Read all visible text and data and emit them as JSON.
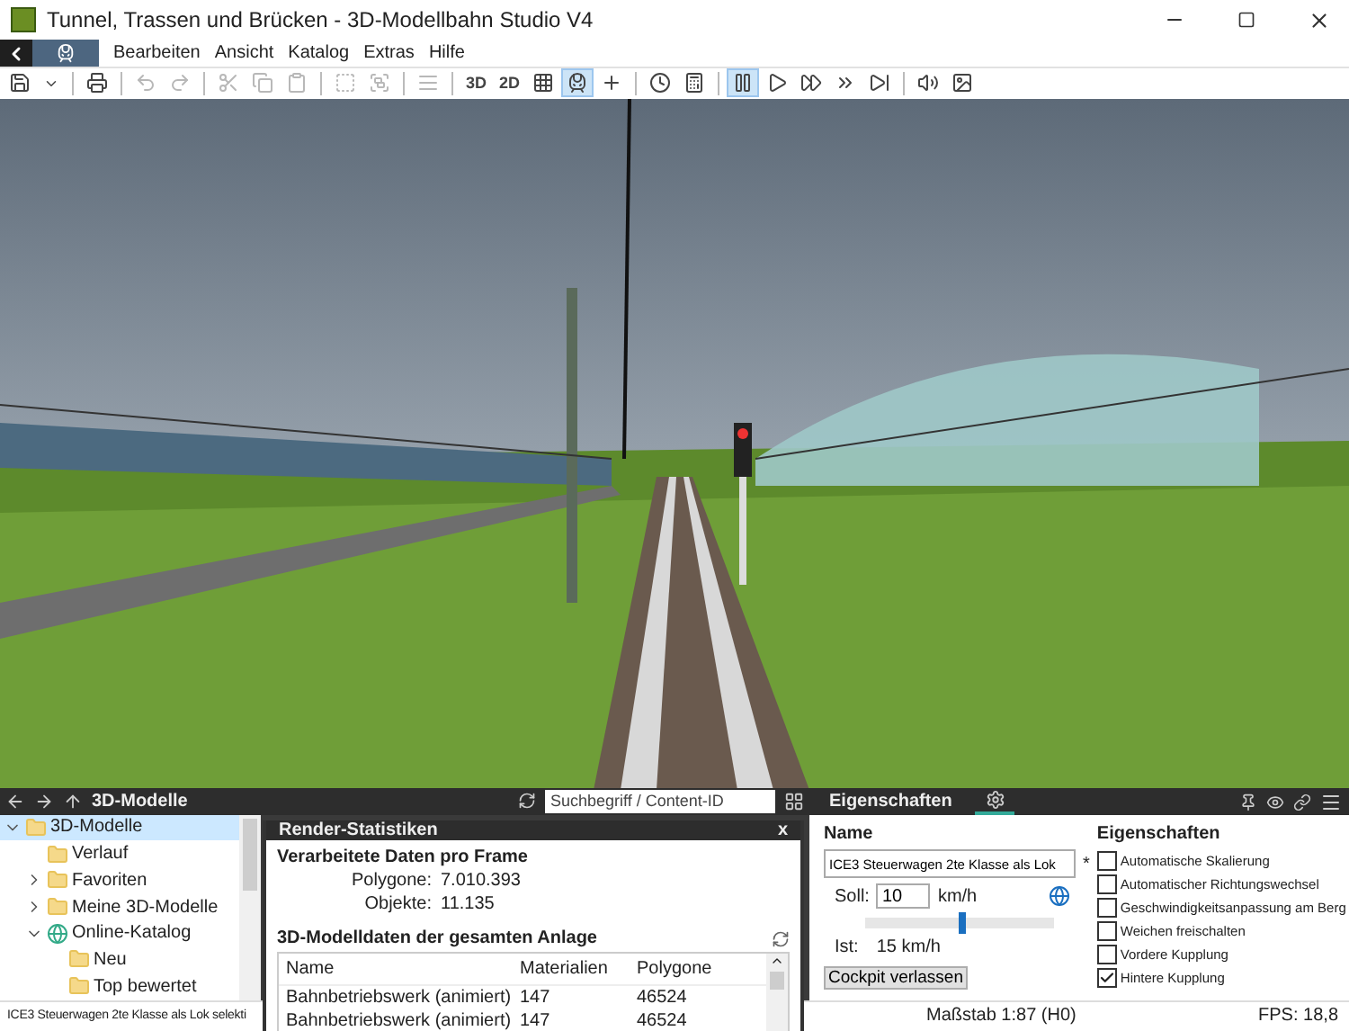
{
  "window": {
    "title": "Tunnel, Trassen und Brücken - 3D-Modellbahn Studio V4"
  },
  "menu": {
    "mode_tab_selected": true,
    "items": [
      "Bearbeiten",
      "Ansicht",
      "Katalog",
      "Extras",
      "Hilfe"
    ]
  },
  "toolbar": [
    {
      "kind": "icon",
      "selected": false,
      "disabled": false
    },
    {
      "kind": "caret",
      "selected": false,
      "disabled": false
    },
    {
      "kind": "separator"
    },
    {
      "kind": "icon",
      "selected": false,
      "disabled": false
    },
    {
      "kind": "separator"
    },
    {
      "kind": "icon",
      "selected": false,
      "disabled": true
    },
    {
      "kind": "icon",
      "selected": false,
      "disabled": true
    },
    {
      "kind": "separator"
    },
    {
      "kind": "icon",
      "selected": false,
      "disabled": true
    },
    {
      "kind": "icon",
      "selected": false,
      "disabled": true
    },
    {
      "kind": "icon",
      "selected": false,
      "disabled": true
    },
    {
      "kind": "separator"
    },
    {
      "kind": "icon",
      "selected": false,
      "disabled": true
    },
    {
      "kind": "icon",
      "selected": false,
      "disabled": true
    },
    {
      "kind": "separator"
    },
    {
      "kind": "icon",
      "selected": false,
      "disabled": true
    },
    {
      "kind": "separator"
    },
    {
      "kind": "text",
      "label": "3D",
      "selected": false,
      "disabled": false
    },
    {
      "kind": "text",
      "label": "2D",
      "selected": false,
      "disabled": false
    },
    {
      "kind": "icon",
      "selected": false,
      "disabled": false
    },
    {
      "kind": "icon",
      "selected": true,
      "disabled": false
    },
    {
      "kind": "icon",
      "selected": false,
      "disabled": false
    },
    {
      "kind": "separator"
    },
    {
      "kind": "icon",
      "selected": false,
      "disabled": false
    },
    {
      "kind": "icon",
      "selected": false,
      "disabled": false
    },
    {
      "kind": "separator"
    },
    {
      "kind": "icon",
      "selected": true,
      "disabled": false
    },
    {
      "kind": "icon",
      "selected": false,
      "disabled": false
    },
    {
      "kind": "icon",
      "selected": false,
      "disabled": false
    },
    {
      "kind": "icon",
      "selected": false,
      "disabled": false
    },
    {
      "kind": "icon",
      "selected": false,
      "disabled": false
    },
    {
      "kind": "separator"
    },
    {
      "kind": "icon",
      "selected": false,
      "disabled": false
    },
    {
      "kind": "icon",
      "selected": false,
      "disabled": false
    }
  ],
  "catalog": {
    "title": "3D-Modelle",
    "search": {
      "placeholder": "Suchbegriff / Content-ID"
    },
    "tree": [
      {
        "label": "3D-Modelle",
        "selected": true,
        "expanded": true,
        "children": [
          {
            "label": "Verlauf",
            "selected": false
          },
          {
            "label": "Favoriten",
            "selected": false,
            "expanded": false
          },
          {
            "label": "Meine 3D-Modelle",
            "selected": false,
            "expanded": false
          },
          {
            "label": "Online-Katalog",
            "selected": false,
            "expanded": true,
            "children": [
              {
                "label": "Neu",
                "selected": false
              },
              {
                "label": "Top bewertet",
                "selected": false
              }
            ]
          }
        ]
      }
    ],
    "status": "ICE3 Steuerwagen 2te Klasse als Lok selekti"
  },
  "render_stats": {
    "title": "Render-Statistiken",
    "close": "x",
    "section_1": "Verarbeitete Daten pro Frame",
    "stats": [
      {
        "label": "Polygone:",
        "value": "7.010.393"
      },
      {
        "label": "Objekte:",
        "value": "11.135"
      }
    ],
    "section_2": "3D-Modelldaten der gesamten Anlage",
    "table": {
      "columns": [
        "Name",
        "Materialien",
        "Polygone"
      ],
      "rows": [
        [
          "Bahnbetriebswerk (animiert)",
          "147",
          "46524"
        ],
        [
          "Bahnbetriebswerk (animiert)",
          "147",
          "46524"
        ]
      ]
    }
  },
  "properties": {
    "tab": "Eigenschaften",
    "name_label": "Name",
    "name_value": "ICE3 Steuerwagen 2te Klasse als Lok",
    "modified_mark": "*",
    "soll_label": "Soll:",
    "soll_value": "10",
    "unit": "km/h",
    "speed": {
      "level": 0.51
    },
    "ist_label": "Ist:",
    "ist_value": "15 km/h",
    "button": "Cockpit verlassen",
    "options_title": "Eigenschaften",
    "options": [
      {
        "label": "Automatische Skalierung",
        "checked": false
      },
      {
        "label": "Automatischer Richtungswechsel",
        "checked": false
      },
      {
        "label": "Geschwindigkeitsanpassung am Berg",
        "checked": false
      },
      {
        "label": "Weichen freischalten",
        "checked": false
      },
      {
        "label": "Vordere Kupplung",
        "checked": false
      },
      {
        "label": "Hintere Kupplung",
        "checked": true
      }
    ],
    "status_scale": "Maßstab 1:87 (H0)",
    "status_fps": "FPS: 18,8"
  }
}
